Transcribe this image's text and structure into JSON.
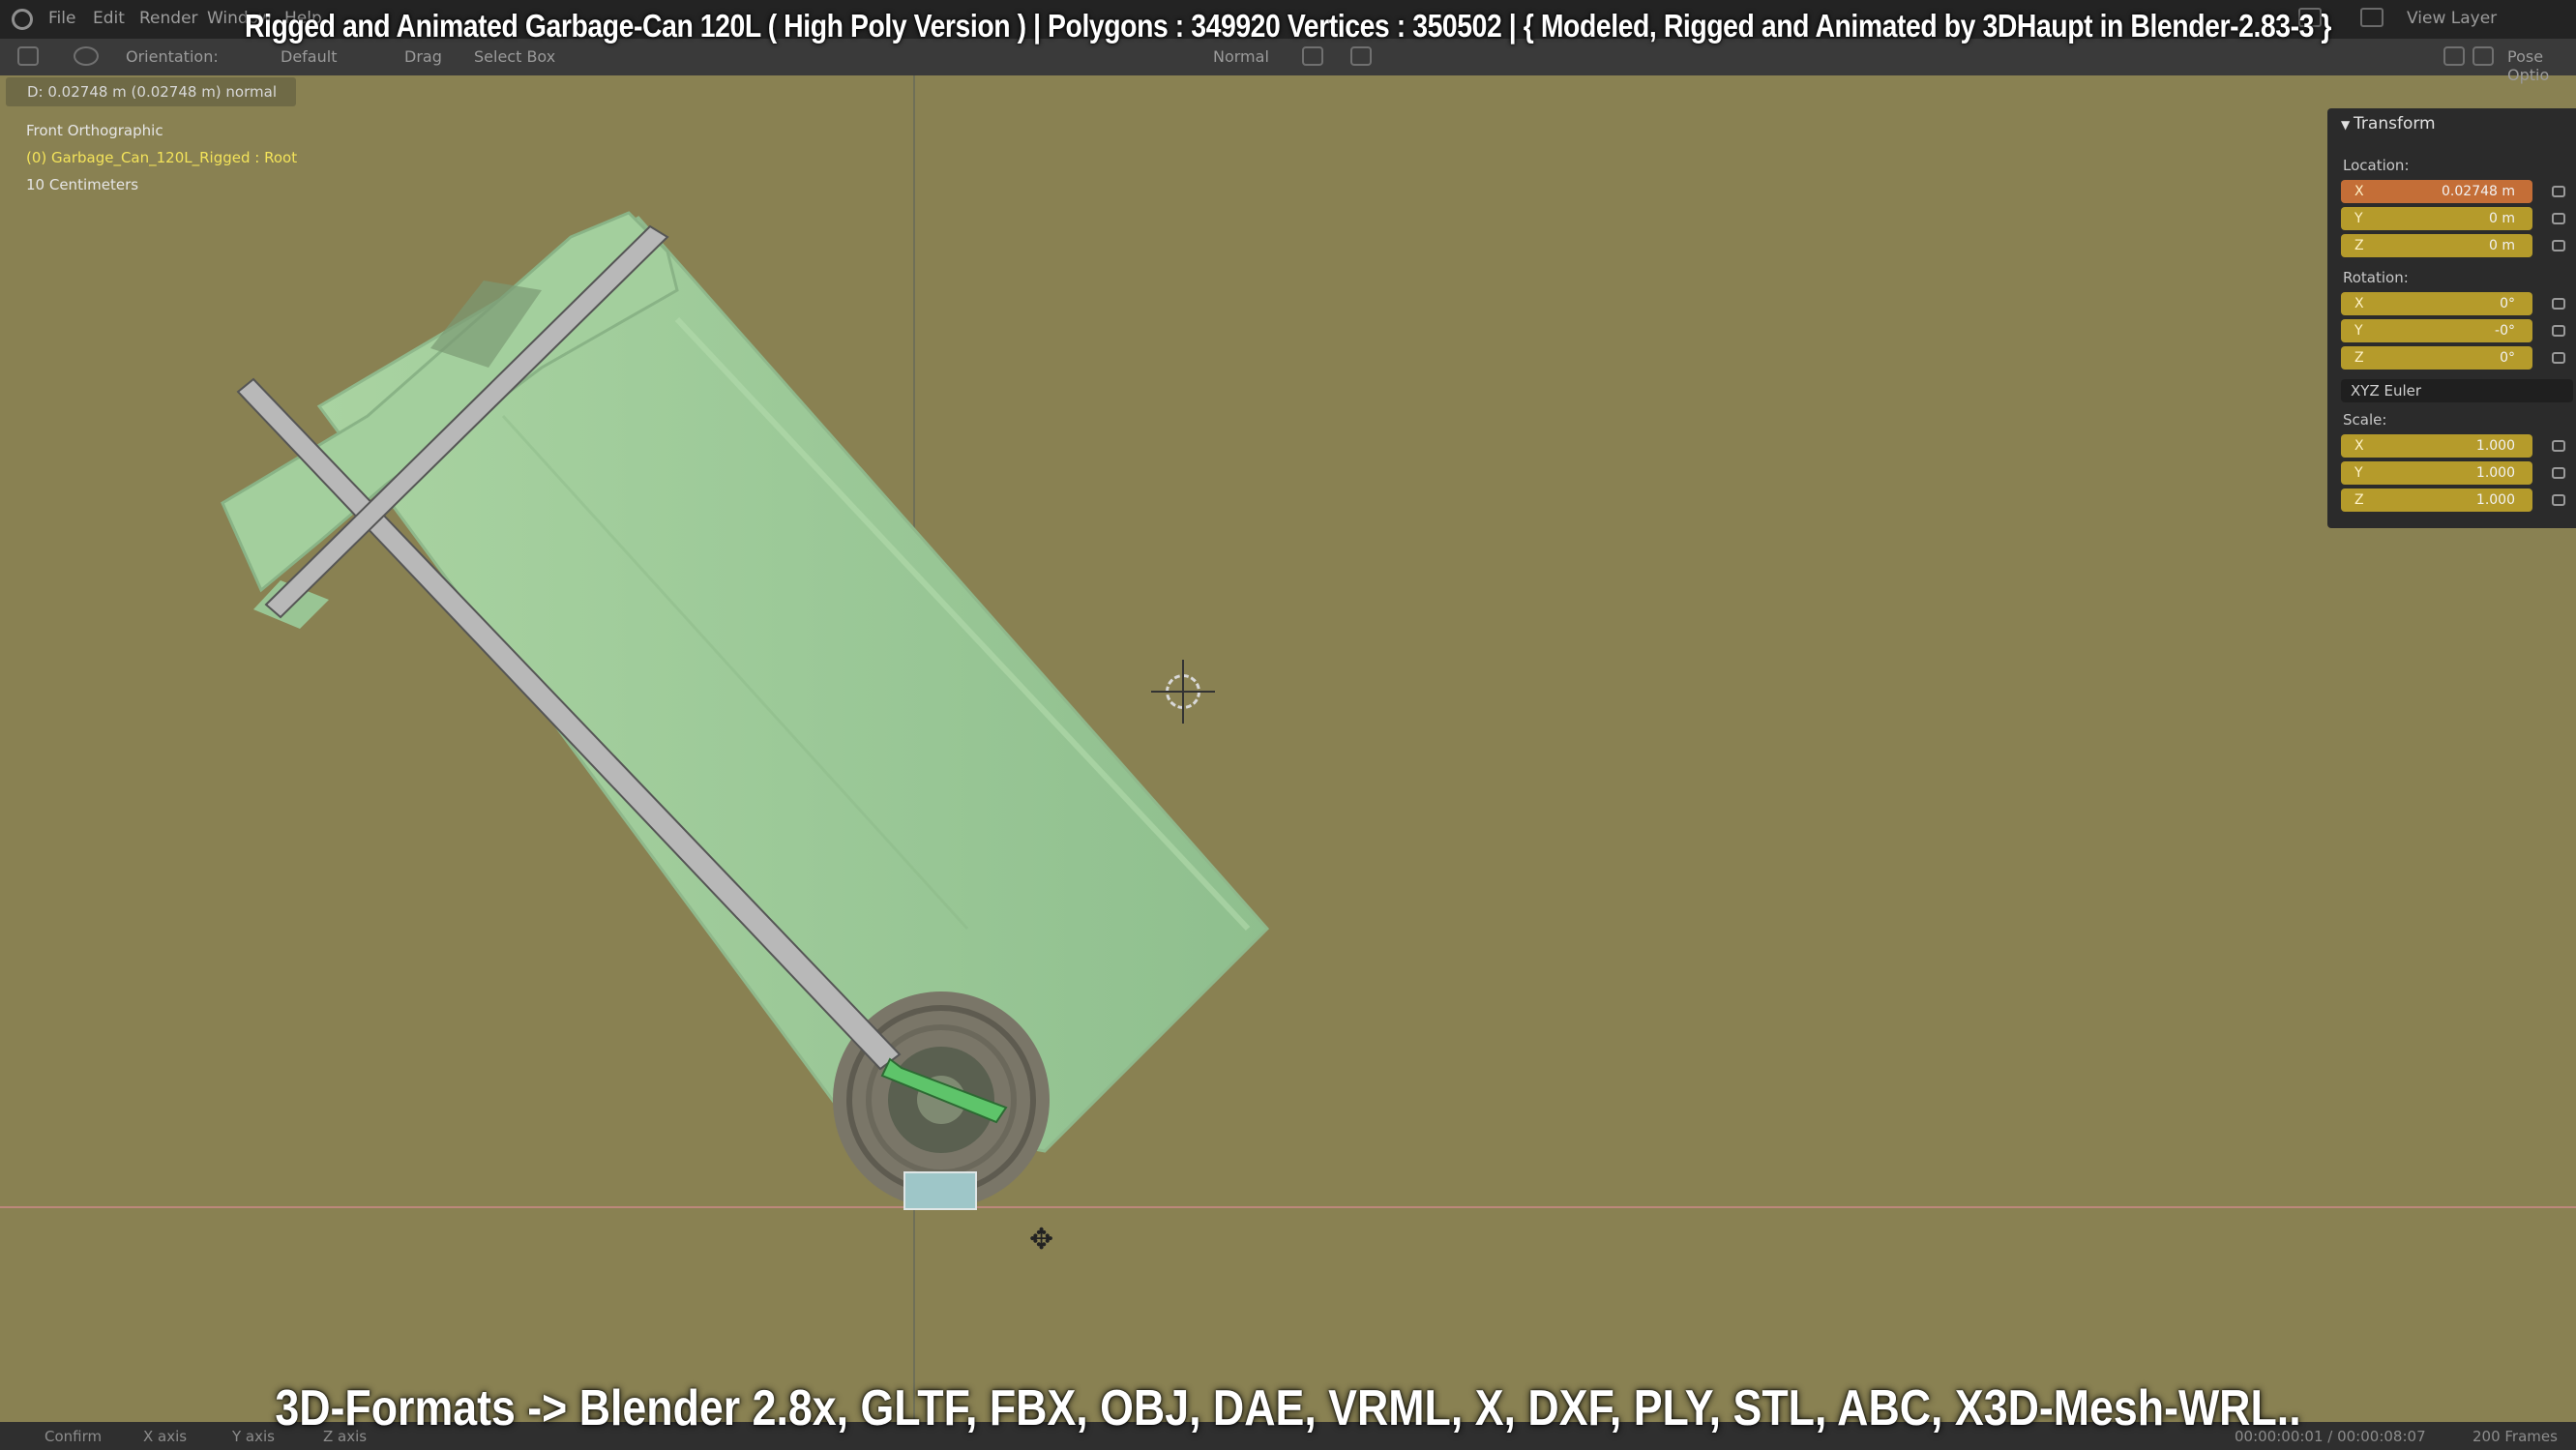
{
  "menubar": {
    "items": [
      "File",
      "Edit",
      "Render",
      "Window",
      "Help"
    ],
    "view_layer": "View Layer"
  },
  "toolbar": {
    "orientation_label": "Orientation:",
    "orientation_value": "Default",
    "drag_label": "Drag",
    "drag_value": "Select Box",
    "transform_pivot": "Normal",
    "right_label": "Pose Optio"
  },
  "overlay": {
    "title": "Rigged and Animated Garbage-Can 120L ( High Poly Version ) |  Polygons : 349920  Vertices : 350502   |   { Modeled, Rigged and Animated by 3DHaupt in Blender-2.83-3 }",
    "formats": "3D-Formats -> Blender 2.8x, GLTF, FBX, OBJ, DAE, VRML, X, DXF, PLY, STL, ABC, X3D-Mesh-WRL.."
  },
  "viewport": {
    "status_d": "D: 0.02748 m (0.02748 m) normal",
    "view_name": "Front Orthographic",
    "object_name": "(0) Garbage_Can_120L_Rigged : Root",
    "scale_text": "10 Centimeters"
  },
  "panel": {
    "title": "Transform",
    "location_label": "Location:",
    "location": [
      {
        "axis": "X",
        "value": "0.02748 m"
      },
      {
        "axis": "Y",
        "value": "0 m"
      },
      {
        "axis": "Z",
        "value": "0 m"
      }
    ],
    "rotation_label": "Rotation:",
    "rotation": [
      {
        "axis": "X",
        "value": "0°"
      },
      {
        "axis": "Y",
        "value": "-0°"
      },
      {
        "axis": "Z",
        "value": "0°"
      }
    ],
    "rotation_mode": "XYZ Euler",
    "scale_label": "Scale:",
    "scale": [
      {
        "axis": "X",
        "value": "1.000"
      },
      {
        "axis": "Y",
        "value": "1.000"
      },
      {
        "axis": "Z",
        "value": "1.000"
      }
    ]
  },
  "statusbar": {
    "confirm": "Confirm",
    "x_axis": "X axis",
    "y_axis": "Y axis",
    "z_axis": "Z axis",
    "time": "00:00:00:01 / 00:00:08:07",
    "frames": "200 Frames"
  },
  "colors": {
    "viewport_bg": "#898152",
    "mesh": "#9fcb9a",
    "bone": "#b5b5b5",
    "active_bone": "#5ec46a",
    "active_field": "#c46e37",
    "field": "#b59b2b"
  }
}
